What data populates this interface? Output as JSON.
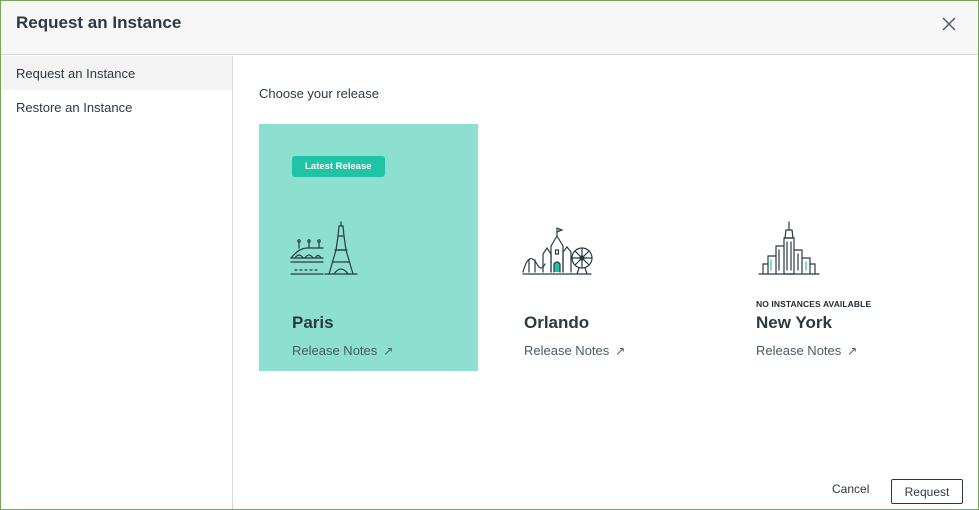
{
  "header": {
    "title": "Request an Instance",
    "close_icon": "close-icon"
  },
  "sidebar": {
    "items": [
      {
        "label": "Request an Instance",
        "active": true
      },
      {
        "label": "Restore an Instance",
        "active": false
      }
    ]
  },
  "main": {
    "section_title": "Choose your release",
    "releases": [
      {
        "badge": "Latest Release",
        "status": "",
        "city": "Paris",
        "notes_label": "Release Notes",
        "notes_icon": "↗",
        "selected": true,
        "icon": "eiffel-tower-icon"
      },
      {
        "badge": "",
        "status": "",
        "city": "Orlando",
        "notes_label": "Release Notes",
        "notes_icon": "↗",
        "selected": false,
        "icon": "castle-icon"
      },
      {
        "badge": "",
        "status": "NO INSTANCES AVAILABLE",
        "city": "New York",
        "notes_label": "Release Notes",
        "notes_icon": "↗",
        "selected": false,
        "icon": "skyline-icon"
      }
    ]
  },
  "footer": {
    "cancel_label": "Cancel",
    "request_label": "Request"
  },
  "colors": {
    "accent": "#1fc4a4",
    "selected_card": "#8ddfd0",
    "frame": "#7aa35a",
    "text": "#2b3a3f"
  }
}
